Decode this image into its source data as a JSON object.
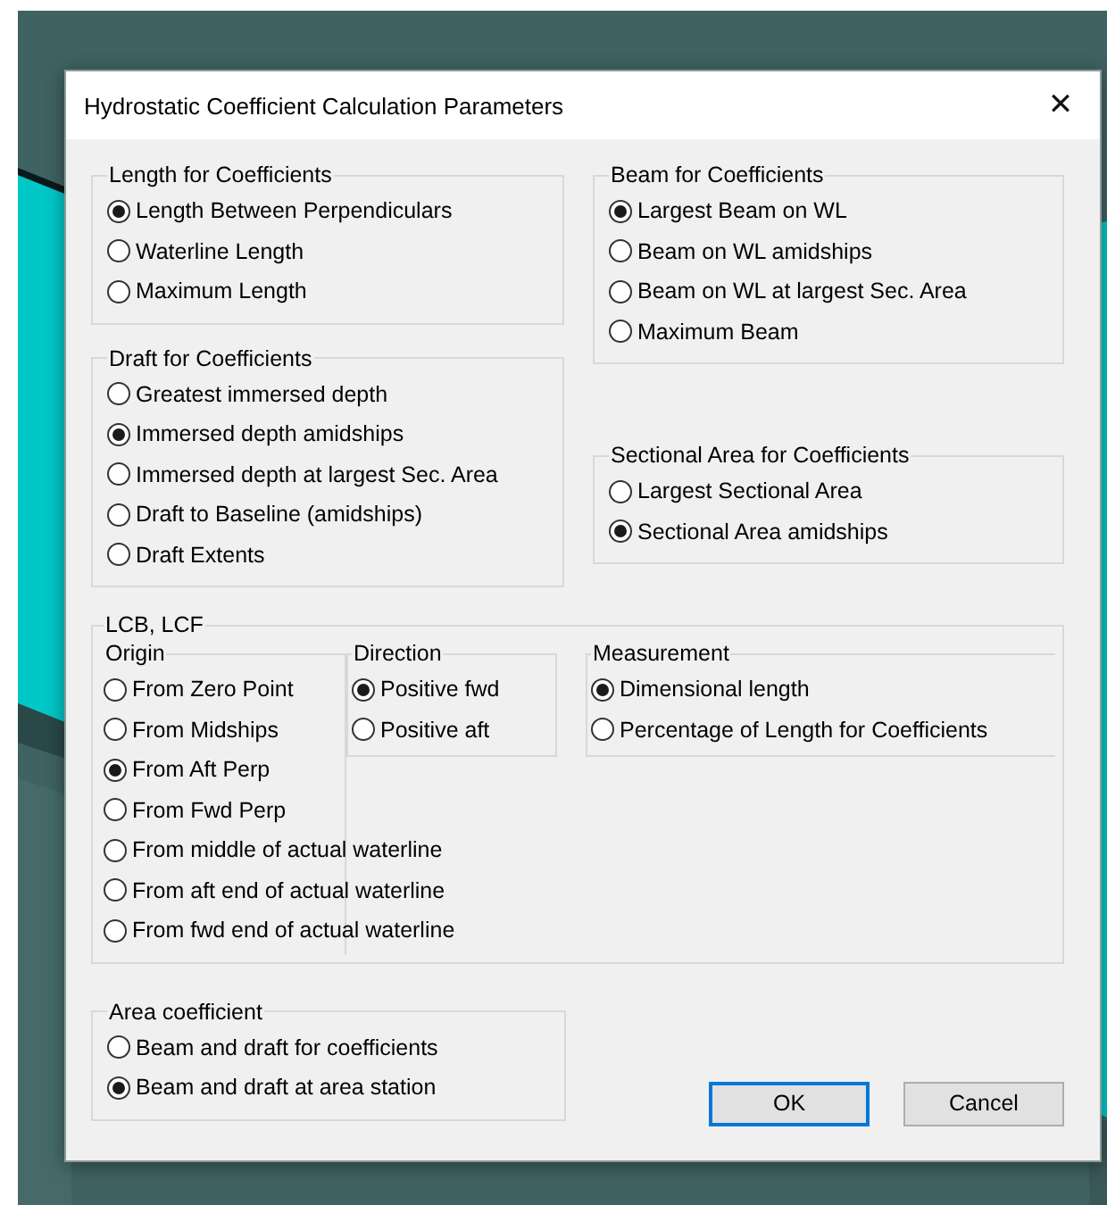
{
  "window": {
    "title": "Hydrostatic Coefficient Calculation Parameters",
    "close": "✕"
  },
  "length": {
    "title": "Length for Coefficients",
    "options": [
      {
        "label": "Length Between Perpendiculars",
        "selected": true
      },
      {
        "label": "Waterline Length",
        "selected": false
      },
      {
        "label": "Maximum Length",
        "selected": false
      }
    ]
  },
  "beam": {
    "title": "Beam for Coefficients",
    "options": [
      {
        "label": "Largest Beam on WL",
        "selected": true
      },
      {
        "label": "Beam on WL amidships",
        "selected": false
      },
      {
        "label": "Beam on WL at largest Sec. Area",
        "selected": false
      },
      {
        "label": "Maximum Beam",
        "selected": false
      }
    ]
  },
  "draft": {
    "title": "Draft for Coefficients",
    "options": [
      {
        "label": "Greatest immersed depth",
        "selected": false
      },
      {
        "label": "Immersed depth amidships",
        "selected": true
      },
      {
        "label": "Immersed depth at largest Sec. Area",
        "selected": false
      },
      {
        "label": "Draft to Baseline (amidships)",
        "selected": false
      },
      {
        "label": "Draft Extents",
        "selected": false
      }
    ]
  },
  "sectional_area": {
    "title": "Sectional Area for Coefficients",
    "options": [
      {
        "label": "Largest Sectional Area",
        "selected": false
      },
      {
        "label": "Sectional Area amidships",
        "selected": true
      }
    ]
  },
  "lcb_lcf": {
    "title": "LCB, LCF",
    "origin": {
      "title": "Origin",
      "options": [
        {
          "label": "From Zero Point",
          "selected": false
        },
        {
          "label": "From Midships",
          "selected": false
        },
        {
          "label": "From Aft Perp",
          "selected": true
        },
        {
          "label": "From Fwd Perp",
          "selected": false
        },
        {
          "label": "From middle of actual waterline",
          "selected": false
        },
        {
          "label": "From aft end of actual waterline",
          "selected": false
        },
        {
          "label": "From fwd end of actual waterline",
          "selected": false
        }
      ]
    },
    "direction": {
      "title": "Direction",
      "options": [
        {
          "label": "Positive fwd",
          "selected": true
        },
        {
          "label": "Positive aft",
          "selected": false
        }
      ]
    },
    "measurement": {
      "title": "Measurement",
      "options": [
        {
          "label": "Dimensional length",
          "selected": true
        },
        {
          "label": "Percentage of Length for Coefficients",
          "selected": false
        }
      ]
    }
  },
  "area_coefficient": {
    "title": "Area coefficient",
    "options": [
      {
        "label": "Beam and draft for coefficients",
        "selected": false
      },
      {
        "label": "Beam and draft at area station",
        "selected": true
      }
    ]
  },
  "buttons": [
    {
      "label": "OK",
      "default": true
    },
    {
      "label": "Cancel",
      "default": false
    }
  ]
}
